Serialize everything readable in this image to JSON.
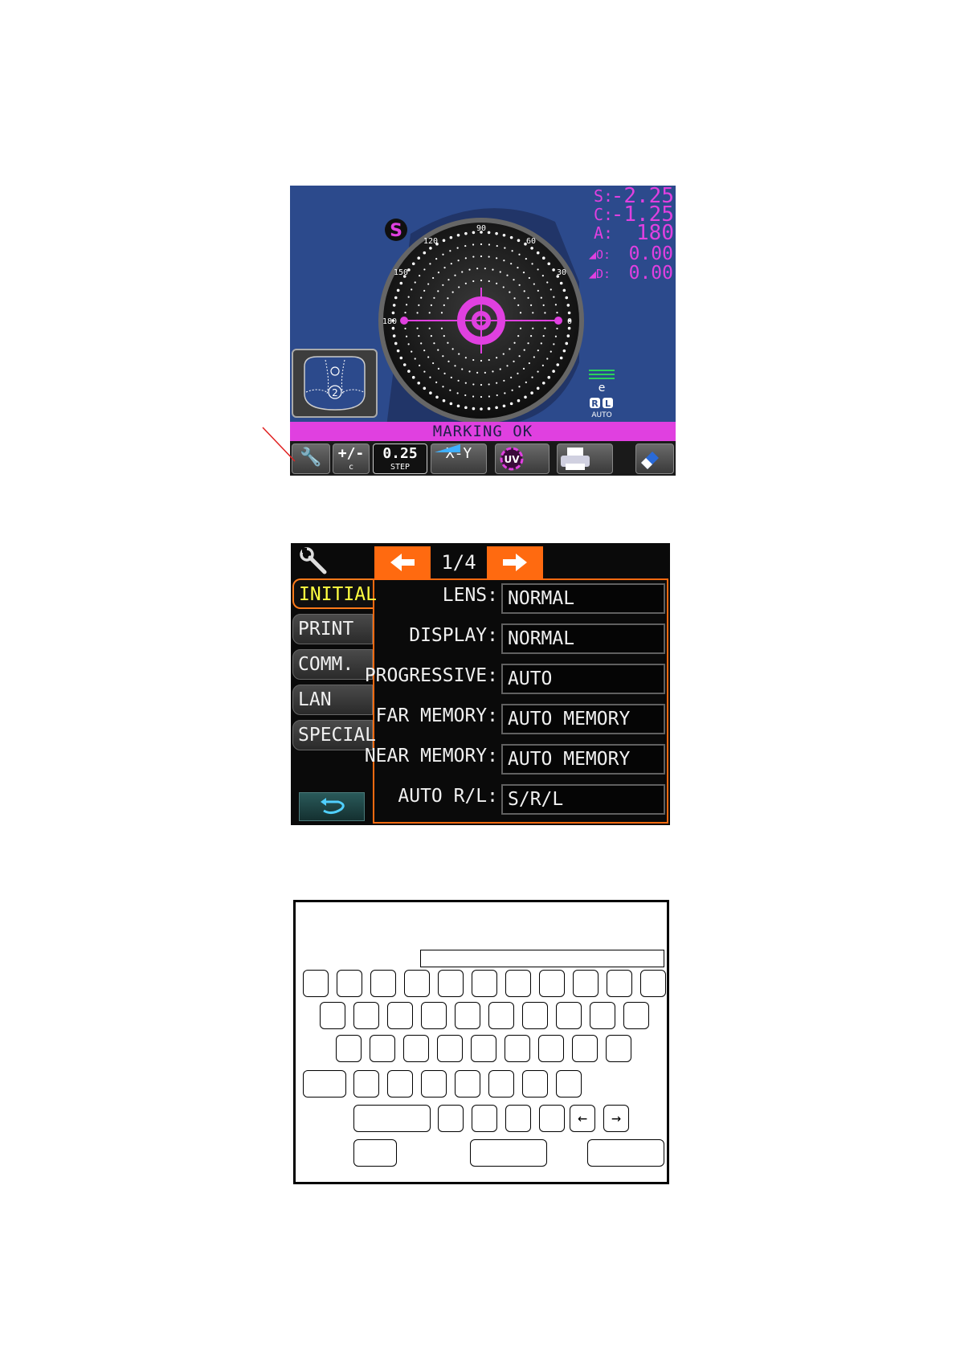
{
  "screen1": {
    "readings": {
      "s_label": "S:",
      "s_value": "-2.25",
      "c_label": "C:",
      "c_value": "-1.25",
      "a_label": "A:",
      "a_value": "180",
      "prism_o_label": "O:",
      "prism_o_value": "0.00",
      "prism_d_label": "D:",
      "prism_d_value": "0.00"
    },
    "mode_badge": "S",
    "axis_labels": [
      "90",
      "60",
      "30",
      "0",
      "120",
      "150",
      "180"
    ],
    "e_label": "e",
    "rl_labels": [
      "R",
      "L"
    ],
    "rl_auto": "AUTO",
    "lens_number": "2",
    "status": "MARKING OK",
    "toolbar": {
      "plusminus_main": "+/-",
      "plusminus_sub": "c",
      "step_main": "0.25",
      "step_sub": "STEP",
      "xy_label": "X-Y",
      "uv_label": "UV"
    },
    "colors": {
      "background": "#2c4a8c",
      "accent": "#e040e0",
      "status_bar": "#e040e0"
    }
  },
  "screen2": {
    "page_indicator": "1/4",
    "tabs": [
      "INITIAL",
      "PRINT",
      "COMM.",
      "LAN",
      "SPECIAL"
    ],
    "active_tab": "INITIAL",
    "settings": [
      {
        "label": "LENS:",
        "value": "NORMAL"
      },
      {
        "label": "DISPLAY:",
        "value": "NORMAL"
      },
      {
        "label": "PROGRESSIVE:",
        "value": "AUTO"
      },
      {
        "label": "FAR MEMORY:",
        "value": "AUTO MEMORY"
      },
      {
        "label": "NEAR MEMORY:",
        "value": "AUTO MEMORY"
      },
      {
        "label": "AUTO R/L:",
        "value": "S/R/L"
      }
    ],
    "colors": {
      "accent": "#ff6a10",
      "active_tab_text": "#ffff40"
    }
  },
  "screen3": {
    "arrow_left": "←",
    "arrow_right": "→"
  }
}
